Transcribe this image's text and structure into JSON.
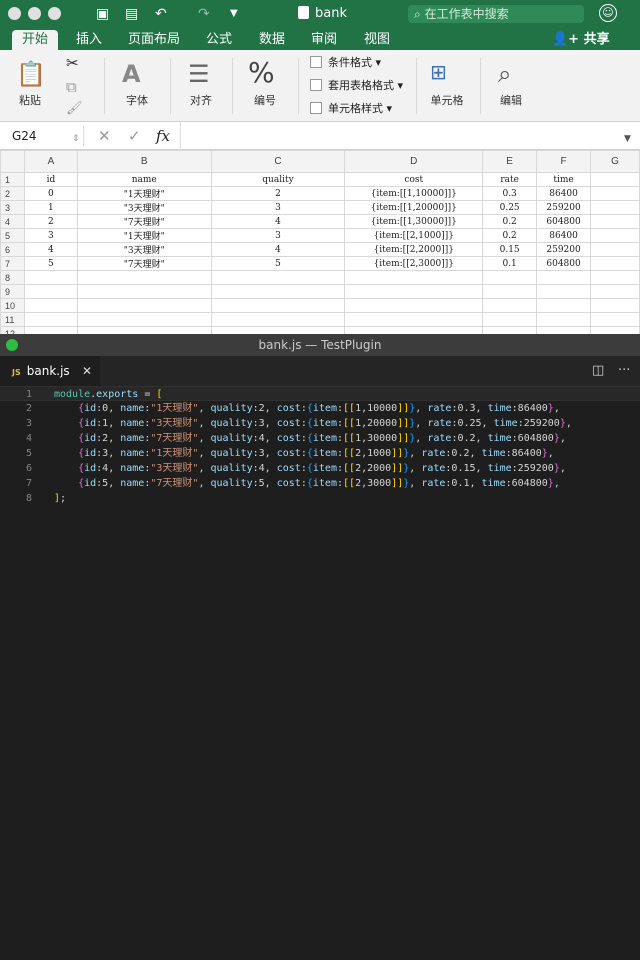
{
  "excel": {
    "title": "bank",
    "search_placeholder": "在工作表中搜索",
    "tabs": [
      "开始",
      "插入",
      "页面布局",
      "公式",
      "数据",
      "审阅",
      "视图"
    ],
    "share_label": "共享",
    "ribbon": {
      "paste": "粘贴",
      "font": "字体",
      "align": "对齐",
      "number": "编号",
      "cond_format": "条件格式",
      "table_format": "套用表格格式",
      "cell_style": "单元格样式",
      "cells": "单元格",
      "edit": "编辑"
    },
    "name_box": "G24",
    "fx": "fx",
    "columns": [
      "A",
      "B",
      "C",
      "D",
      "E",
      "F",
      "G"
    ],
    "rows": [
      {
        "n": "1",
        "cells": [
          "id",
          "name",
          "quality",
          "cost",
          "rate",
          "time",
          ""
        ]
      },
      {
        "n": "2",
        "cells": [
          "0",
          "\"1天理财\"",
          "2",
          "{item:[[1,10000]]}",
          "0.3",
          "86400",
          ""
        ]
      },
      {
        "n": "3",
        "cells": [
          "1",
          "\"3天理财\"",
          "3",
          "{item:[[1,20000]]}",
          "0.25",
          "259200",
          ""
        ]
      },
      {
        "n": "4",
        "cells": [
          "2",
          "\"7天理财\"",
          "4",
          "{item:[[1,30000]]}",
          "0.2",
          "604800",
          ""
        ]
      },
      {
        "n": "5",
        "cells": [
          "3",
          "\"1天理财\"",
          "3",
          "{item:[[2,1000]]}",
          "0.2",
          "86400",
          ""
        ]
      },
      {
        "n": "6",
        "cells": [
          "4",
          "\"3天理财\"",
          "4",
          "{item:[[2,2000]]}",
          "0.15",
          "259200",
          ""
        ]
      },
      {
        "n": "7",
        "cells": [
          "5",
          "\"7天理财\"",
          "5",
          "{item:[[2,3000]]}",
          "0.1",
          "604800",
          ""
        ]
      },
      {
        "n": "8",
        "cells": [
          "",
          "",
          "",
          "",
          "",
          "",
          ""
        ]
      },
      {
        "n": "9",
        "cells": [
          "",
          "",
          "",
          "",
          "",
          "",
          ""
        ]
      },
      {
        "n": "10",
        "cells": [
          "",
          "",
          "",
          "",
          "",
          "",
          ""
        ]
      },
      {
        "n": "11",
        "cells": [
          "",
          "",
          "",
          "",
          "",
          "",
          ""
        ]
      },
      {
        "n": "12",
        "cells": [
          "",
          "",
          "",
          "",
          "",
          "",
          ""
        ]
      }
    ]
  },
  "editor": {
    "window_title": "bank.js — TestPlugin",
    "tab_label": "bank.js",
    "tab_badge": "JS",
    "code_lines": [
      [
        {
          "t": "module",
          "c": "#4ec9b0"
        },
        {
          "t": ".",
          "c": "#d4d4d4"
        },
        {
          "t": "exports",
          "c": "#9cdcfe"
        },
        {
          "t": " = ",
          "c": "#d4d4d4"
        },
        {
          "t": "[",
          "c": "#ffd700"
        }
      ],
      [
        {
          "t": "    {",
          "c": "#da70d6"
        },
        {
          "t": "id",
          "c": "#9cdcfe"
        },
        {
          "t": ":0, ",
          "c": "#d4d4d4"
        },
        {
          "t": "name",
          "c": "#9cdcfe"
        },
        {
          "t": ":",
          "c": "#d4d4d4"
        },
        {
          "t": "\"1天理财\"",
          "c": "#ce9178"
        },
        {
          "t": ", ",
          "c": "#d4d4d4"
        },
        {
          "t": "quality",
          "c": "#9cdcfe"
        },
        {
          "t": ":2, ",
          "c": "#d4d4d4"
        },
        {
          "t": "cost",
          "c": "#9cdcfe"
        },
        {
          "t": ":",
          "c": "#d4d4d4"
        },
        {
          "t": "{",
          "c": "#179fff"
        },
        {
          "t": "item",
          "c": "#9cdcfe"
        },
        {
          "t": ":",
          "c": "#d4d4d4"
        },
        {
          "t": "[[",
          "c": "#ffd700"
        },
        {
          "t": "1,10000",
          "c": "#d4d4d4"
        },
        {
          "t": "]]",
          "c": "#ffd700"
        },
        {
          "t": "}",
          "c": "#179fff"
        },
        {
          "t": ", ",
          "c": "#d4d4d4"
        },
        {
          "t": "rate",
          "c": "#9cdcfe"
        },
        {
          "t": ":0.3, ",
          "c": "#d4d4d4"
        },
        {
          "t": "time",
          "c": "#9cdcfe"
        },
        {
          "t": ":86400",
          "c": "#d4d4d4"
        },
        {
          "t": "}",
          "c": "#da70d6"
        },
        {
          "t": ",",
          "c": "#d4d4d4"
        }
      ],
      [
        {
          "t": "    {",
          "c": "#da70d6"
        },
        {
          "t": "id",
          "c": "#9cdcfe"
        },
        {
          "t": ":1, ",
          "c": "#d4d4d4"
        },
        {
          "t": "name",
          "c": "#9cdcfe"
        },
        {
          "t": ":",
          "c": "#d4d4d4"
        },
        {
          "t": "\"3天理财\"",
          "c": "#ce9178"
        },
        {
          "t": ", ",
          "c": "#d4d4d4"
        },
        {
          "t": "quality",
          "c": "#9cdcfe"
        },
        {
          "t": ":3, ",
          "c": "#d4d4d4"
        },
        {
          "t": "cost",
          "c": "#9cdcfe"
        },
        {
          "t": ":",
          "c": "#d4d4d4"
        },
        {
          "t": "{",
          "c": "#179fff"
        },
        {
          "t": "item",
          "c": "#9cdcfe"
        },
        {
          "t": ":",
          "c": "#d4d4d4"
        },
        {
          "t": "[[",
          "c": "#ffd700"
        },
        {
          "t": "1,20000",
          "c": "#d4d4d4"
        },
        {
          "t": "]]",
          "c": "#ffd700"
        },
        {
          "t": "}",
          "c": "#179fff"
        },
        {
          "t": ", ",
          "c": "#d4d4d4"
        },
        {
          "t": "rate",
          "c": "#9cdcfe"
        },
        {
          "t": ":0.25, ",
          "c": "#d4d4d4"
        },
        {
          "t": "time",
          "c": "#9cdcfe"
        },
        {
          "t": ":259200",
          "c": "#d4d4d4"
        },
        {
          "t": "}",
          "c": "#da70d6"
        },
        {
          "t": ",",
          "c": "#d4d4d4"
        }
      ],
      [
        {
          "t": "    {",
          "c": "#da70d6"
        },
        {
          "t": "id",
          "c": "#9cdcfe"
        },
        {
          "t": ":2, ",
          "c": "#d4d4d4"
        },
        {
          "t": "name",
          "c": "#9cdcfe"
        },
        {
          "t": ":",
          "c": "#d4d4d4"
        },
        {
          "t": "\"7天理财\"",
          "c": "#ce9178"
        },
        {
          "t": ", ",
          "c": "#d4d4d4"
        },
        {
          "t": "quality",
          "c": "#9cdcfe"
        },
        {
          "t": ":4, ",
          "c": "#d4d4d4"
        },
        {
          "t": "cost",
          "c": "#9cdcfe"
        },
        {
          "t": ":",
          "c": "#d4d4d4"
        },
        {
          "t": "{",
          "c": "#179fff"
        },
        {
          "t": "item",
          "c": "#9cdcfe"
        },
        {
          "t": ":",
          "c": "#d4d4d4"
        },
        {
          "t": "[[",
          "c": "#ffd700"
        },
        {
          "t": "1,30000",
          "c": "#d4d4d4"
        },
        {
          "t": "]]",
          "c": "#ffd700"
        },
        {
          "t": "}",
          "c": "#179fff"
        },
        {
          "t": ", ",
          "c": "#d4d4d4"
        },
        {
          "t": "rate",
          "c": "#9cdcfe"
        },
        {
          "t": ":0.2, ",
          "c": "#d4d4d4"
        },
        {
          "t": "time",
          "c": "#9cdcfe"
        },
        {
          "t": ":604800",
          "c": "#d4d4d4"
        },
        {
          "t": "}",
          "c": "#da70d6"
        },
        {
          "t": ",",
          "c": "#d4d4d4"
        }
      ],
      [
        {
          "t": "    {",
          "c": "#da70d6"
        },
        {
          "t": "id",
          "c": "#9cdcfe"
        },
        {
          "t": ":3, ",
          "c": "#d4d4d4"
        },
        {
          "t": "name",
          "c": "#9cdcfe"
        },
        {
          "t": ":",
          "c": "#d4d4d4"
        },
        {
          "t": "\"1天理财\"",
          "c": "#ce9178"
        },
        {
          "t": ", ",
          "c": "#d4d4d4"
        },
        {
          "t": "quality",
          "c": "#9cdcfe"
        },
        {
          "t": ":3, ",
          "c": "#d4d4d4"
        },
        {
          "t": "cost",
          "c": "#9cdcfe"
        },
        {
          "t": ":",
          "c": "#d4d4d4"
        },
        {
          "t": "{",
          "c": "#179fff"
        },
        {
          "t": "item",
          "c": "#9cdcfe"
        },
        {
          "t": ":",
          "c": "#d4d4d4"
        },
        {
          "t": "[[",
          "c": "#ffd700"
        },
        {
          "t": "2,1000",
          "c": "#d4d4d4"
        },
        {
          "t": "]]",
          "c": "#ffd700"
        },
        {
          "t": "}",
          "c": "#179fff"
        },
        {
          "t": ", ",
          "c": "#d4d4d4"
        },
        {
          "t": "rate",
          "c": "#9cdcfe"
        },
        {
          "t": ":0.2, ",
          "c": "#d4d4d4"
        },
        {
          "t": "time",
          "c": "#9cdcfe"
        },
        {
          "t": ":86400",
          "c": "#d4d4d4"
        },
        {
          "t": "}",
          "c": "#da70d6"
        },
        {
          "t": ",",
          "c": "#d4d4d4"
        }
      ],
      [
        {
          "t": "    {",
          "c": "#da70d6"
        },
        {
          "t": "id",
          "c": "#9cdcfe"
        },
        {
          "t": ":4, ",
          "c": "#d4d4d4"
        },
        {
          "t": "name",
          "c": "#9cdcfe"
        },
        {
          "t": ":",
          "c": "#d4d4d4"
        },
        {
          "t": "\"3天理财\"",
          "c": "#ce9178"
        },
        {
          "t": ", ",
          "c": "#d4d4d4"
        },
        {
          "t": "quality",
          "c": "#9cdcfe"
        },
        {
          "t": ":4, ",
          "c": "#d4d4d4"
        },
        {
          "t": "cost",
          "c": "#9cdcfe"
        },
        {
          "t": ":",
          "c": "#d4d4d4"
        },
        {
          "t": "{",
          "c": "#179fff"
        },
        {
          "t": "item",
          "c": "#9cdcfe"
        },
        {
          "t": ":",
          "c": "#d4d4d4"
        },
        {
          "t": "[[",
          "c": "#ffd700"
        },
        {
          "t": "2,2000",
          "c": "#d4d4d4"
        },
        {
          "t": "]]",
          "c": "#ffd700"
        },
        {
          "t": "}",
          "c": "#179fff"
        },
        {
          "t": ", ",
          "c": "#d4d4d4"
        },
        {
          "t": "rate",
          "c": "#9cdcfe"
        },
        {
          "t": ":0.15, ",
          "c": "#d4d4d4"
        },
        {
          "t": "time",
          "c": "#9cdcfe"
        },
        {
          "t": ":259200",
          "c": "#d4d4d4"
        },
        {
          "t": "}",
          "c": "#da70d6"
        },
        {
          "t": ",",
          "c": "#d4d4d4"
        }
      ],
      [
        {
          "t": "    {",
          "c": "#da70d6"
        },
        {
          "t": "id",
          "c": "#9cdcfe"
        },
        {
          "t": ":5, ",
          "c": "#d4d4d4"
        },
        {
          "t": "name",
          "c": "#9cdcfe"
        },
        {
          "t": ":",
          "c": "#d4d4d4"
        },
        {
          "t": "\"7天理财\"",
          "c": "#ce9178"
        },
        {
          "t": ", ",
          "c": "#d4d4d4"
        },
        {
          "t": "quality",
          "c": "#9cdcfe"
        },
        {
          "t": ":5, ",
          "c": "#d4d4d4"
        },
        {
          "t": "cost",
          "c": "#9cdcfe"
        },
        {
          "t": ":",
          "c": "#d4d4d4"
        },
        {
          "t": "{",
          "c": "#179fff"
        },
        {
          "t": "item",
          "c": "#9cdcfe"
        },
        {
          "t": ":",
          "c": "#d4d4d4"
        },
        {
          "t": "[[",
          "c": "#ffd700"
        },
        {
          "t": "2,3000",
          "c": "#d4d4d4"
        },
        {
          "t": "]]",
          "c": "#ffd700"
        },
        {
          "t": "}",
          "c": "#179fff"
        },
        {
          "t": ", ",
          "c": "#d4d4d4"
        },
        {
          "t": "rate",
          "c": "#9cdcfe"
        },
        {
          "t": ":0.1, ",
          "c": "#d4d4d4"
        },
        {
          "t": "time",
          "c": "#9cdcfe"
        },
        {
          "t": ":604800",
          "c": "#d4d4d4"
        },
        {
          "t": "}",
          "c": "#da70d6"
        },
        {
          "t": ",",
          "c": "#d4d4d4"
        }
      ],
      [
        {
          "t": "]",
          "c": "#ffd700"
        },
        {
          "t": ";",
          "c": "#d4d4d4"
        }
      ]
    ]
  },
  "colors": {
    "excel_green": "#217346",
    "editor_bg": "#1e1e1e"
  }
}
